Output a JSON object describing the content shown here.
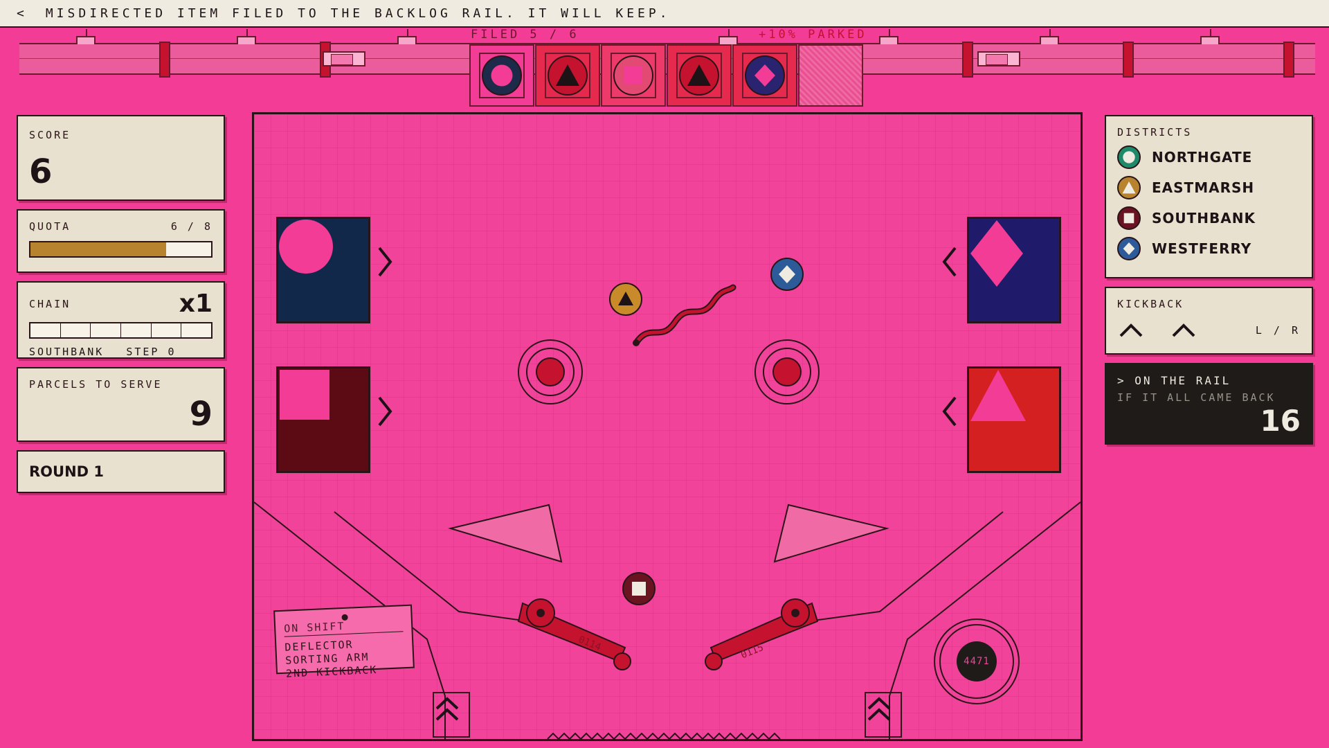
{
  "message_bar": {
    "back_label": "<",
    "message": "MISDIRECTED ITEM FILED TO THE BACKLOG RAIL. IT WILL KEEP."
  },
  "rail": {
    "filed_label": "FILED 5 / 6",
    "parked_label": "+10% PARKED",
    "filed": 5,
    "capacity": 6,
    "slots": [
      {
        "shape": "circle",
        "district": "northgate",
        "bg": "#f23c96",
        "icon_bg": "#1d2a4a",
        "icon_fg": "#f23c96"
      },
      {
        "shape": "triangle",
        "district": "eastmarsh",
        "bg": "#e52a4e",
        "icon_bg": "#c4122f",
        "icon_fg": "#1d1216"
      },
      {
        "shape": "square",
        "district": "southbank",
        "bg": "#ee3a6a",
        "icon_bg": "#e24a74",
        "icon_fg": "#f23c96"
      },
      {
        "shape": "triangle",
        "district": "eastmarsh",
        "bg": "#e52a4e",
        "icon_bg": "#c4122f",
        "icon_fg": "#1d1216"
      },
      {
        "shape": "diamond",
        "district": "westferry",
        "bg": "#e52a4e",
        "icon_bg": "#2a2370",
        "icon_fg": "#f23c96"
      },
      {
        "shape": "empty"
      }
    ]
  },
  "score": {
    "label": "SCORE",
    "value": "6"
  },
  "quota": {
    "label": "QUOTA",
    "text": "6 / 8",
    "current": 6,
    "target": 8
  },
  "chain": {
    "label": "CHAIN",
    "multiplier": "x1",
    "segments": 6,
    "district": "SOUTHBANK",
    "step": "STEP 0"
  },
  "parcels": {
    "label": "PARCELS TO SERVE",
    "value": "9"
  },
  "round": {
    "label": "ROUND 1"
  },
  "districts": {
    "label": "DISTRICTS",
    "items": [
      {
        "name": "NORTHGATE",
        "shape": "circle",
        "color": "#1e8a6a"
      },
      {
        "name": "EASTMARSH",
        "shape": "triangle",
        "color": "#b7832f"
      },
      {
        "name": "SOUTHBANK",
        "shape": "square",
        "color": "#6a1422"
      },
      {
        "name": "WESTFERRY",
        "shape": "diamond",
        "color": "#2d5b9a"
      }
    ]
  },
  "kickback": {
    "label": "KICKBACK",
    "lr": "L / R"
  },
  "rail_panel": {
    "line1": "> ON THE RAIL",
    "line2": "IF IT ALL CAME BACK",
    "value": "16"
  },
  "board": {
    "chutes": [
      {
        "side": "left",
        "shape": "circle",
        "bg": "#12284a"
      },
      {
        "side": "left",
        "shape": "square",
        "bg": "#5c0a14"
      },
      {
        "side": "right",
        "shape": "diamond",
        "bg": "#1f1a6a"
      },
      {
        "side": "right",
        "shape": "triangle",
        "bg": "#d42020"
      }
    ],
    "shift_card": {
      "title": "ON SHIFT",
      "lines": [
        "DEFLECTOR",
        "SORTING ARM",
        "2ND KICKBACK"
      ]
    },
    "flipper_left_label": "0114",
    "flipper_right_label": "0115",
    "drain_label": "4471",
    "balls": [
      {
        "shape": "triangle",
        "color": "#c98a2a",
        "fg": "#1d1216"
      },
      {
        "shape": "diamond",
        "color": "#2d5b9a",
        "fg": "#f0ebe0"
      },
      {
        "shape": "square",
        "color": "#6a1422",
        "fg": "#f0ebe0"
      }
    ]
  },
  "colors": {
    "background": "#f23c96",
    "panel": "#e9e1cf",
    "ink": "#2a1418",
    "quota_fill": "#b7832f",
    "accent_red": "#c4122f"
  }
}
